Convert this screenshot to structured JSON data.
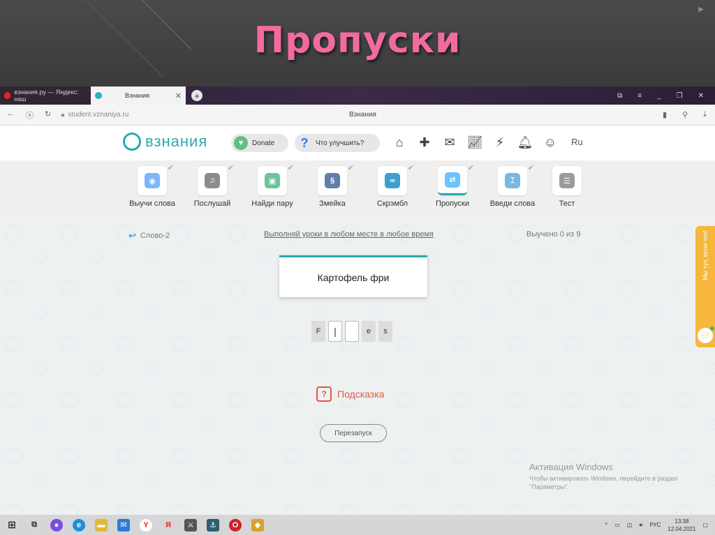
{
  "slide": {
    "title": "Пропуски"
  },
  "browser": {
    "tabs": [
      {
        "label": "взнания.ру — Яндекс: наш",
        "active": false
      },
      {
        "label": "Взнания",
        "active": true
      }
    ],
    "url": "student.vznaniya.ru",
    "page_title": "Взнания"
  },
  "site": {
    "logo_text": "взнания",
    "donate_label": "Donate",
    "improve_label": "Что улучшить?",
    "lang": "Ru"
  },
  "activities": [
    {
      "label": "Выучи слова",
      "color": "#7bb6ff",
      "selected": false
    },
    {
      "label": "Послушай",
      "color": "#8c8c8c",
      "selected": false
    },
    {
      "label": "Найди пару",
      "color": "#6ac39c",
      "selected": false
    },
    {
      "label": "Змейка",
      "color": "#5f7ea8",
      "selected": false
    },
    {
      "label": "Скрэмбл",
      "color": "#3ca0d0",
      "selected": false
    },
    {
      "label": "Пропуски",
      "color": "#6cc3ff",
      "selected": true
    },
    {
      "label": "Введи слова",
      "color": "#79b7e3",
      "selected": false
    },
    {
      "label": "Тест",
      "color": "#9b9b9b",
      "selected": false
    }
  ],
  "exercise": {
    "back_label": "Слово-2",
    "anywhere_label": "Выполняй уроки в любом месте в любое время",
    "progress_label": "Выучено 0 из 9",
    "word": "Картофель фри",
    "letters": [
      "F",
      "",
      "",
      "e",
      "s"
    ],
    "hint_label": "Подсказка",
    "restart_label": "Перезапуск"
  },
  "activation": {
    "title": "Активация Windows",
    "line1": "Чтобы активировать Windows, перейдите в раздел",
    "line2": "\"Параметры\"."
  },
  "chat": {
    "label": "Мы тут, если что!"
  },
  "taskbar": {
    "lang": "РУС",
    "time": "13:38",
    "date": "12.04.2021"
  }
}
